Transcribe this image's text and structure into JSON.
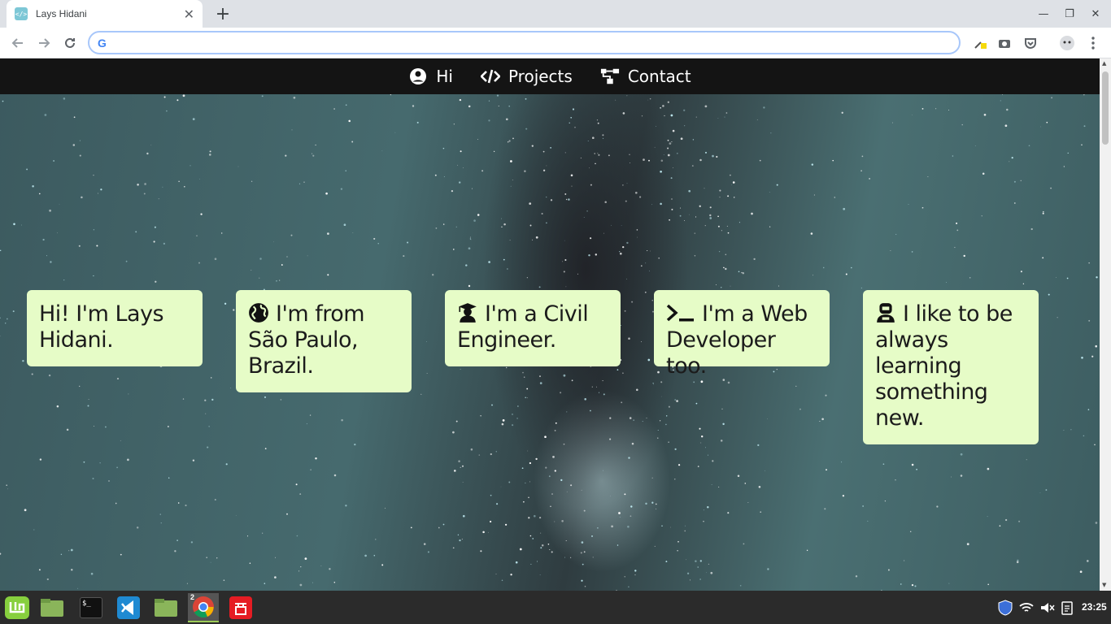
{
  "browser": {
    "tab_title": "Lays Hidani",
    "tab_close": "✕",
    "new_tab": "+",
    "omnibox_value": "",
    "google_letter": "G",
    "window_controls": [
      "—",
      "❐",
      "✕"
    ]
  },
  "nav": {
    "items": [
      {
        "label": "Hi",
        "icon": "user-circle-icon"
      },
      {
        "label": "Projects",
        "icon": "code-icon"
      },
      {
        "label": "Contact",
        "icon": "sitemap-icon"
      }
    ]
  },
  "cards": [
    {
      "text": "Hi! I'm Lays Hidani.",
      "icon": ""
    },
    {
      "text": "I'm from São Paulo, Brazil.",
      "icon": "globe-icon"
    },
    {
      "text": "I'm a Civil Engineer.",
      "icon": "graduate-icon"
    },
    {
      "text": "I'm a Web Developer too.",
      "icon": "terminal-icon"
    },
    {
      "text": "I like to be always learning something new.",
      "icon": "robot-icon"
    }
  ],
  "colors": {
    "card_bg": "#e6fcc7",
    "nav_bg": "#141414",
    "taskbar_bg": "#2b2b2b"
  },
  "taskbar": {
    "apps": [
      "mint-menu-icon",
      "files-icon",
      "terminal-icon",
      "vscode-icon",
      "folder-icon",
      "chrome-icon",
      "app-red-icon"
    ],
    "chrome_badge": "2",
    "terminal_label": "$_",
    "clock": "23:25"
  }
}
